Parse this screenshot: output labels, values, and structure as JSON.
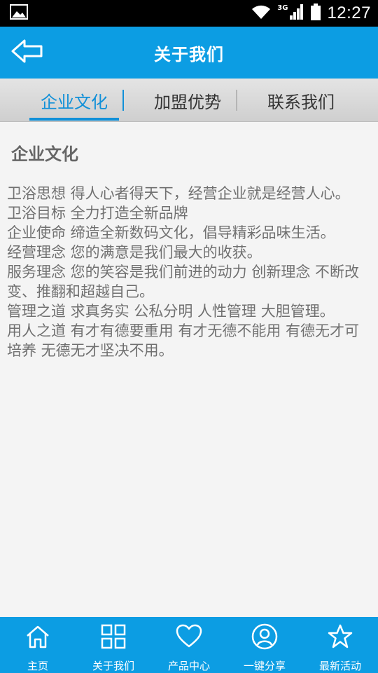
{
  "status_bar": {
    "time": "12:27",
    "network_type": "3G",
    "icons": [
      "image-icon",
      "wifi-icon",
      "signal-icon",
      "battery-icon"
    ]
  },
  "header": {
    "title": "关于我们",
    "back_icon": "back-arrow-icon"
  },
  "tabs": [
    {
      "label": "企业文化",
      "active": true
    },
    {
      "label": "加盟优势",
      "active": false
    },
    {
      "label": "联系我们",
      "active": false
    }
  ],
  "content": {
    "section_title": "企业文化",
    "paragraphs": [
      "卫浴思想 得人心者得天下，经营企业就是经营人心。",
      "卫浴目标 全力打造全新品牌",
      "企业使命 缔造全新数码文化，倡导精彩品味生活。",
      "经营理念 您的满意是我们最大的收获。",
      "服务理念 您的笑容是我们前进的动力 创新理念 不断改变、推翻和超越自己。",
      "管理之道 求真务实 公私分明 人性管理 大胆管理。",
      "用人之道 有才有德要重用 有才无德不能用 有德无才可培养 无德无才坚决不用。"
    ]
  },
  "bottom_nav": [
    {
      "label": "主页",
      "icon": "home-icon"
    },
    {
      "label": "关于我们",
      "icon": "grid-icon"
    },
    {
      "label": "产品中心",
      "icon": "heart-icon"
    },
    {
      "label": "一键分享",
      "icon": "user-circle-icon"
    },
    {
      "label": "最新活动",
      "icon": "star-icon"
    }
  ],
  "colors": {
    "primary": "#0c9de3",
    "active_tab": "#1190d8",
    "text": "#707070"
  }
}
